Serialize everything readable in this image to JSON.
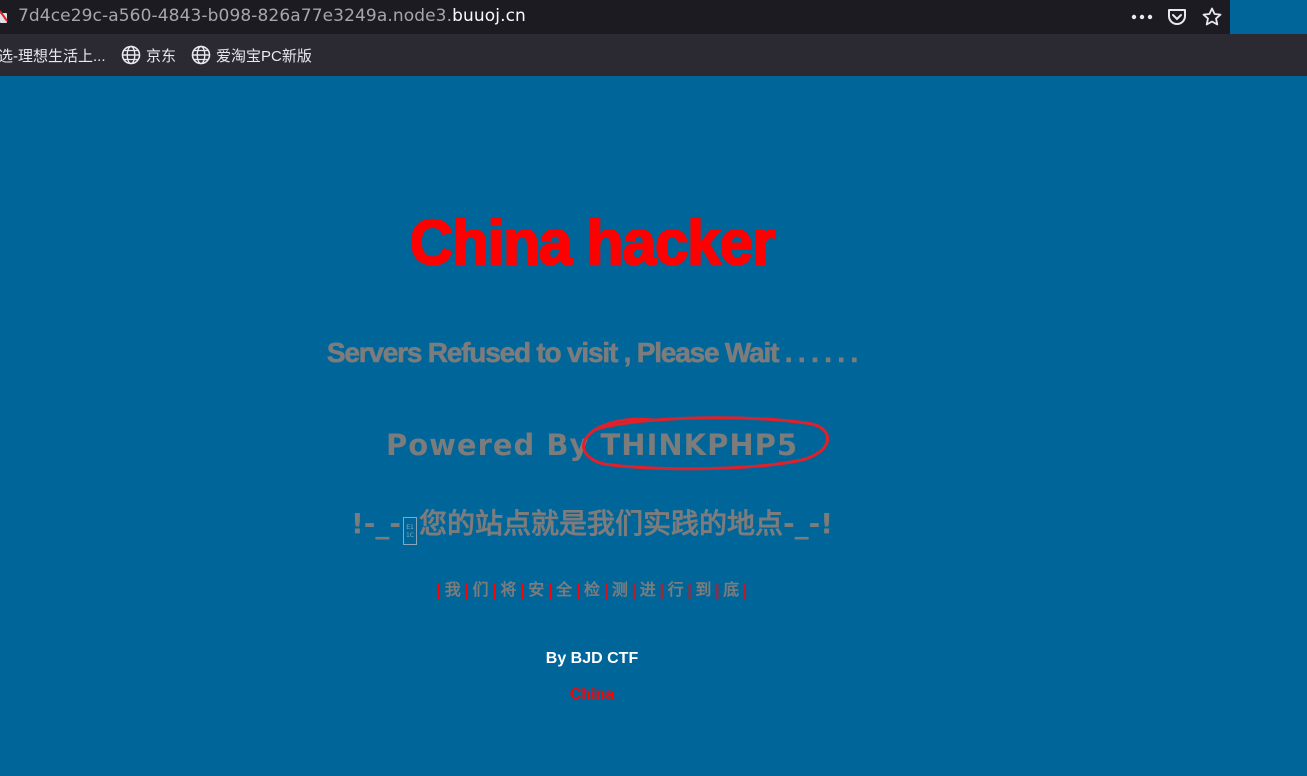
{
  "browser": {
    "url_prefix": "7d4ce29c-a560-4843-b098-826a77e3249a.node3.",
    "url_domain": "buuoj.cn",
    "toolbar_icons": [
      "more-icon",
      "pocket-icon",
      "bookmark-star-icon"
    ],
    "bookmarks": [
      {
        "label": "选-理想生活上..."
      },
      {
        "label": "京东",
        "icon": "globe-icon"
      },
      {
        "label": "爱淘宝PC新版",
        "icon": "globe-icon"
      }
    ]
  },
  "page": {
    "title": "China hacker",
    "subtitle": "Servers Refused to visit , Please Wait . . . . . .",
    "powered_prefix": "Powered By ",
    "powered_name": "THINKPHP5",
    "slogan_left": "!-_-",
    "slogan_right": "您的站点就是我们实践的地点-_-!",
    "characters": [
      "我",
      "们",
      "将",
      "安",
      "全",
      "检",
      "测",
      "进",
      "行",
      "到",
      "底"
    ],
    "byline": "By BJD CTF",
    "footer": "China"
  },
  "colors": {
    "page_bg": "#006699",
    "title": "#ff0000",
    "gray_text": "#7c7c7c",
    "annotation_circle": "#e0202a"
  }
}
